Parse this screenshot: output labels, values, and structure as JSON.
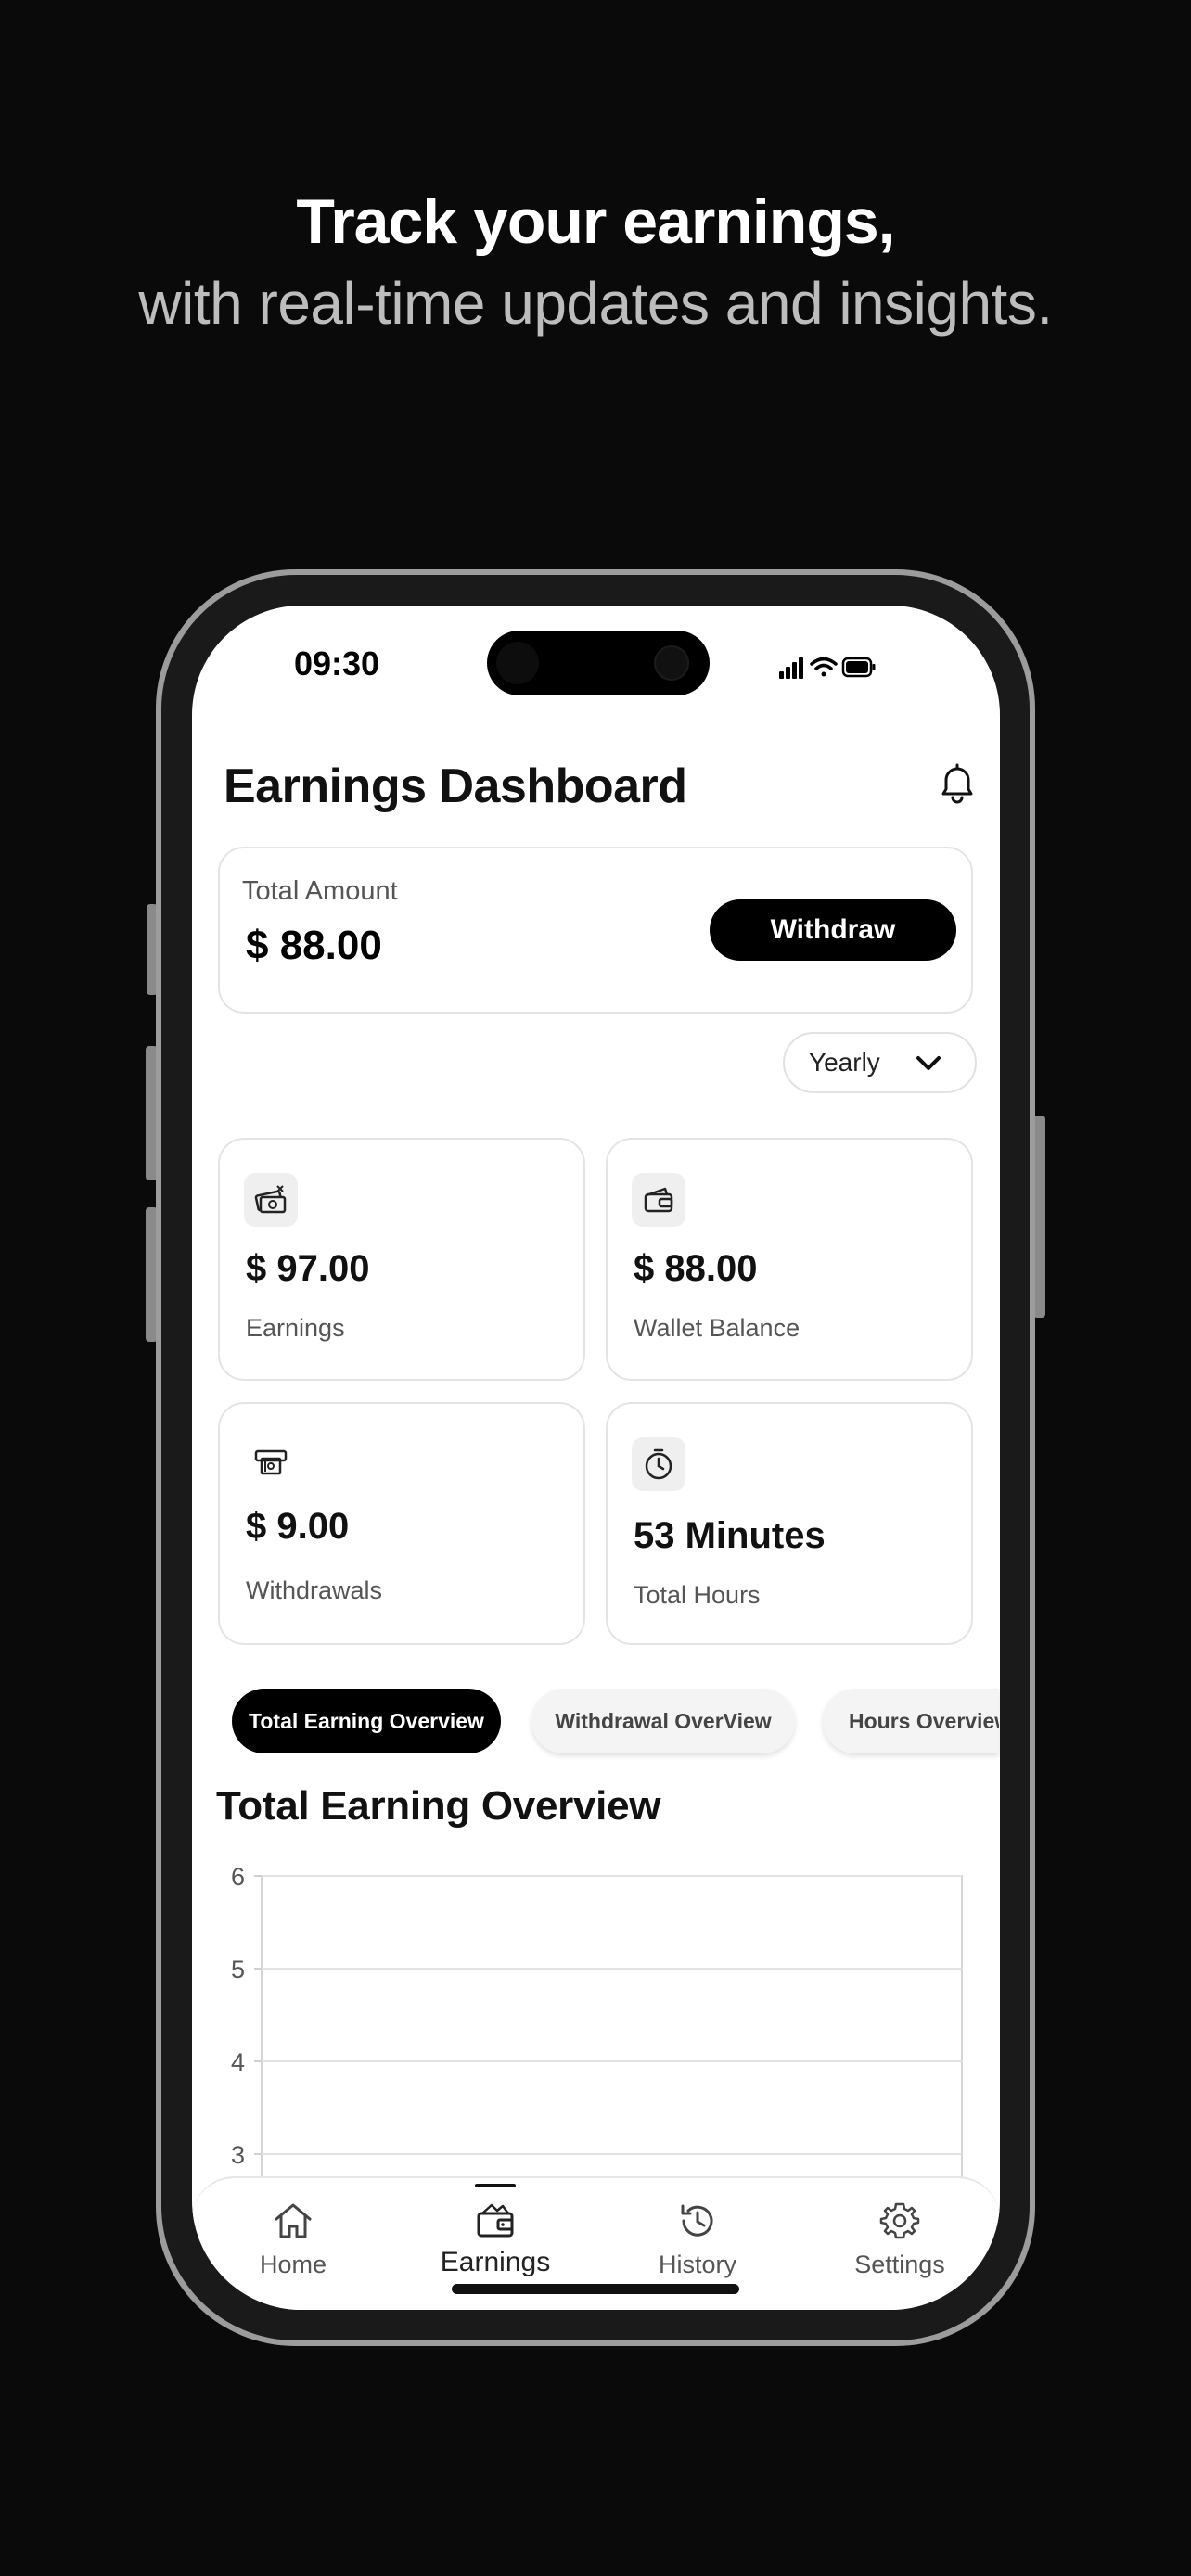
{
  "promo": {
    "headline": "Track your earnings,",
    "subheadline": "with real-time updates and insights."
  },
  "status_bar": {
    "time": "09:30"
  },
  "header": {
    "title": "Earnings Dashboard"
  },
  "total_card": {
    "label": "Total Amount",
    "value": "$ 88.00",
    "withdraw_label": "Withdraw"
  },
  "period_select": {
    "selected": "Yearly"
  },
  "stats": [
    {
      "value": "$ 97.00",
      "label": "Earnings",
      "icon": "cash-icon"
    },
    {
      "value": "$ 88.00",
      "label": "Wallet Balance",
      "icon": "wallet-icon"
    },
    {
      "value": "$ 9.00",
      "label": "Withdrawals",
      "icon": "atm-icon"
    },
    {
      "value": "53 Minutes",
      "label": "Total Hours",
      "icon": "clock-icon"
    }
  ],
  "tabs": [
    "Total Earning Overview",
    "Withdrawal OverView",
    "Hours Overview"
  ],
  "section_title": "Total Earning Overview",
  "chart_data": {
    "type": "line",
    "title": "",
    "xlabel": "",
    "ylabel": "",
    "y_ticks": [
      6,
      5,
      4,
      3
    ],
    "ylim": [
      3,
      6
    ],
    "grid": true,
    "series": []
  },
  "bottom_nav": [
    {
      "label": "Home",
      "icon": "home-icon"
    },
    {
      "label": "Earnings",
      "icon": "wallet-icon",
      "active": true
    },
    {
      "label": "History",
      "icon": "history-icon"
    },
    {
      "label": "Settings",
      "icon": "gear-icon"
    }
  ],
  "colors": {
    "background": "#0a0a0a",
    "accent": "#000000",
    "subheadline": "#bdbdbd"
  }
}
